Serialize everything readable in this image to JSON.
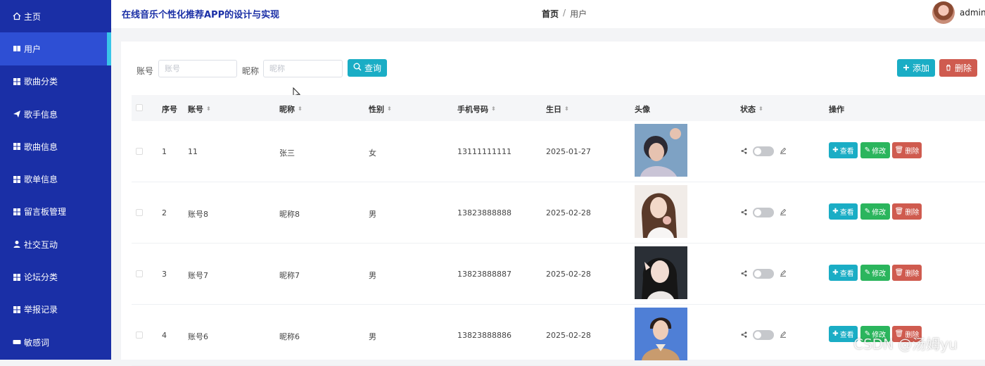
{
  "header": {
    "app_title": "在线音乐个性化推荐APP的设计与实现",
    "user_name": "admin"
  },
  "breadcrumb": {
    "home": "首页",
    "separator": "/",
    "current": "用户"
  },
  "sidebar": {
    "items": [
      {
        "label": "主页",
        "icon": "home-icon"
      },
      {
        "label": "用户",
        "icon": "book-icon"
      },
      {
        "label": "歌曲分类",
        "icon": "grid-icon"
      },
      {
        "label": "歌手信息",
        "icon": "send-icon"
      },
      {
        "label": "歌曲信息",
        "icon": "grid-icon"
      },
      {
        "label": "歌单信息",
        "icon": "grid-icon"
      },
      {
        "label": "留言板管理",
        "icon": "grid-icon"
      },
      {
        "label": "社交互动",
        "icon": "user-icon"
      },
      {
        "label": "论坛分类",
        "icon": "grid-icon"
      },
      {
        "label": "举报记录",
        "icon": "grid-icon"
      },
      {
        "label": "敏感词",
        "icon": "keyboard-icon"
      }
    ]
  },
  "search": {
    "account_label": "账号",
    "account_placeholder": "账号",
    "nickname_label": "昵称",
    "nickname_placeholder": "昵称",
    "query_button": "查询",
    "add_button": "添加",
    "delete_button": "删除"
  },
  "table": {
    "headers": {
      "index": "序号",
      "account": "账号",
      "nickname": "昵称",
      "gender": "性别",
      "phone": "手机号码",
      "birthday": "生日",
      "avatar": "头像",
      "status": "状态",
      "actions": "操作"
    },
    "actions": {
      "view": "查看",
      "edit": "修改",
      "delete": "删除"
    },
    "rows": [
      {
        "index": "1",
        "account": "11",
        "nickname": "张三",
        "gender": "女",
        "phone": "13111111111",
        "birthday": "2025-01-27"
      },
      {
        "index": "2",
        "account": "账号8",
        "nickname": "昵称8",
        "gender": "男",
        "phone": "13823888888",
        "birthday": "2025-02-28"
      },
      {
        "index": "3",
        "account": "账号7",
        "nickname": "昵称7",
        "gender": "男",
        "phone": "13823888887",
        "birthday": "2025-02-28"
      },
      {
        "index": "4",
        "account": "账号6",
        "nickname": "昵称6",
        "gender": "男",
        "phone": "13823888886",
        "birthday": "2025-02-28"
      }
    ]
  },
  "watermark": "CSDN @汤姆yu",
  "colors": {
    "sidebar": "#1a2fa6",
    "sidebar_active": "#2e4fd4",
    "accent": "#1aadc5",
    "success": "#2bb55d",
    "danger": "#cf5b4f"
  }
}
